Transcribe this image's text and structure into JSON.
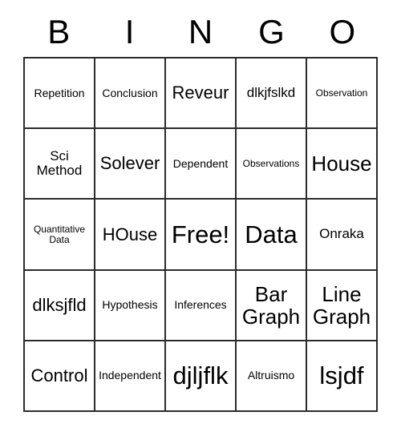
{
  "card": {
    "title": "BINGO",
    "header_letters": [
      "B",
      "I",
      "N",
      "G",
      "O"
    ],
    "rows": [
      [
        {
          "text": "Repetition",
          "size": "s-sm"
        },
        {
          "text": "Conclusion",
          "size": "s-sm"
        },
        {
          "text": "Reveur",
          "size": "s-lg"
        },
        {
          "text": "dlkjfslkd",
          "size": "s-md"
        },
        {
          "text": "Observation",
          "size": "s-xs"
        }
      ],
      [
        {
          "text": "Sci Method",
          "size": "s-md"
        },
        {
          "text": "Solever",
          "size": "s-lg"
        },
        {
          "text": "Dependent",
          "size": "s-sm"
        },
        {
          "text": "Observations",
          "size": "s-xs"
        },
        {
          "text": "House",
          "size": "s-xl"
        }
      ],
      [
        {
          "text": "Quantitative Data",
          "size": "s-xs"
        },
        {
          "text": "HOuse",
          "size": "s-lg"
        },
        {
          "text": "Free!",
          "size": "s-xxl"
        },
        {
          "text": "Data",
          "size": "s-xxl"
        },
        {
          "text": "Onraka",
          "size": "s-md"
        }
      ],
      [
        {
          "text": "dlksjfld",
          "size": "s-lg"
        },
        {
          "text": "Hypothesis",
          "size": "s-sm"
        },
        {
          "text": "Inferences",
          "size": "s-sm"
        },
        {
          "text": "Bar Graph",
          "size": "s-xl"
        },
        {
          "text": "Line Graph",
          "size": "s-xl"
        }
      ],
      [
        {
          "text": "Control",
          "size": "s-lg"
        },
        {
          "text": "Independent",
          "size": "s-sm"
        },
        {
          "text": "djljflk",
          "size": "s-xxl"
        },
        {
          "text": "Altruismo",
          "size": "s-sm"
        },
        {
          "text": "lsjdf",
          "size": "s-xxl"
        }
      ]
    ]
  },
  "colors": {
    "grid_line": "#2b2b2b",
    "text": "#000000",
    "background": "#ffffff"
  }
}
